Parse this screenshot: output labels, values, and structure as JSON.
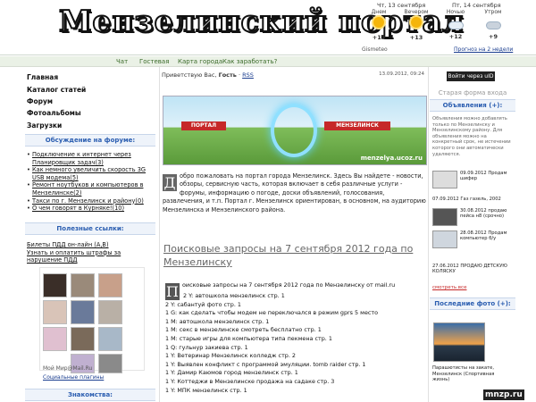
{
  "header": {
    "logo": "Мензелинский портал",
    "weather": {
      "day1": "Чт, 13 сентября",
      "day2": "Пт, 14 сентября",
      "cols": [
        {
          "label": "Днем",
          "temp": "+13",
          "icon": "sun-icon"
        },
        {
          "label": "Вечером",
          "temp": "+13",
          "icon": "sun-icon"
        },
        {
          "label": "Ночью",
          "temp": "+12",
          "icon": "cloud-icon"
        },
        {
          "label": "Утром",
          "temp": "+9",
          "icon": "cloud-icon"
        }
      ],
      "provider": "Gismeteo",
      "forecast_link": "Прогноз на 2 недели"
    }
  },
  "nav": [
    "Чат",
    "Гостевая",
    "Карта города",
    "Как заработать?"
  ],
  "left": {
    "menu": [
      "Главная",
      "Каталог статей",
      "Форум",
      "Фотоальбомы",
      "Загрузки"
    ],
    "forum_title": "Обсуждение на форуме:",
    "forum_items": [
      "Подключение к интернет через Планировщик задач(3)",
      "Как немного увеличить скорость 3G USB модема(5)",
      "Ремонт ноутбуков и компьютеров в Мензелинске(2)",
      "Такси по г. Мензелинск и району(0)",
      "О чем говорят в Курняке!(10)"
    ],
    "links_title": "Полезные ссылки:",
    "links": [
      "Билеты ПДД он-лайн (A,B)",
      "Узнать и оплатить штрафы за нарушение ПДД"
    ],
    "mymir": "Мой Мир@Mail.Ru",
    "social": "Социальные плагины",
    "acquaint_title": "Знакомства:"
  },
  "center": {
    "greeting": "Приветствую Вас, ",
    "guest": "Гость",
    "rss": "RSS",
    "date": "13.09.2012, 09:24",
    "banner_left": "ПОРТАЛ",
    "banner_right": "МЕНЗЕЛИНСК",
    "banner_url": "menzelya.ucoz.ru",
    "intro_drop": "Д",
    "intro": "обро пожаловать на портал города Мензелинск. Здесь Вы найдете - новости, обзоры, сервисную часть, которая включает в себя различные услуги - форумы, информацию о погоде, доски объявлений, голосования, развлечения, и т.п. Портал г. Мензелинск ориентирован, в основном, на аудиторию Мензелинска и Мензелинского района.",
    "article_title": "Поисковые запросы на 7 сентября 2012 года по Мензелинску",
    "article_drop": "П",
    "article_lead": "оисковые запросы на 7 сентября 2012 года по Мензелинску от mail.ru",
    "queries": [
      "2 Y: автошкола мензелинск стр. 1",
      "2 Y: сабантуй фото стр. 1",
      "1 G: как сделать чтобы модем не переключался в режим gprs 5 место",
      "1 M: автошкола мензелинск стр. 1",
      "1 M: секс в мензелинске смотреть бесплатно стр. 1",
      "1 M: старые игры для компьютера типа пекмена стр. 1",
      "1 Q: гульнур закиева стр. 1",
      "1 Y: Ветеринар Мензелинск колледж стр. 2",
      "1 Y: Выявлен конфликт с программой эмуляции. tomb raider стр. 1",
      "1 Y: Дамир Каюмов город мензелинск стр. 1",
      "1 Y: Коттеджи в Мензелинске продажа на садаке стр. 3",
      "1 Y: МПК мензелинск стр. 1"
    ]
  },
  "right": {
    "login": "Войти через uID",
    "old_form": "Старая форма входа",
    "ads_title": "Объявления (+):",
    "ads_intro": "Объявления можно добавлять только по Мензелинску и Мензелинскому району. Для объявления можно на конкретный срок, не истечении которого они автоматически удаляются.",
    "ads": [
      {
        "text": "09.09.2012 Продам шифер"
      },
      {
        "text": "07.09.2012 Газ газель, 2002"
      },
      {
        "text": "30.08.2012 продаю пейса н8 (срочно)"
      },
      {
        "text": "28.08.2012 Продам компьютер б/у"
      },
      {
        "text": "27.06.2012 ПРОДАЮ ДЕТСКУЮ КОЛЯСКУ"
      }
    ],
    "more": "смотреть все",
    "last_photo_title": "Последние фото (+):",
    "photo_caption": "Парашютисты на закате, Мензелинск (Спортивная жизнь)"
  },
  "watermark": "mnzp.ru"
}
